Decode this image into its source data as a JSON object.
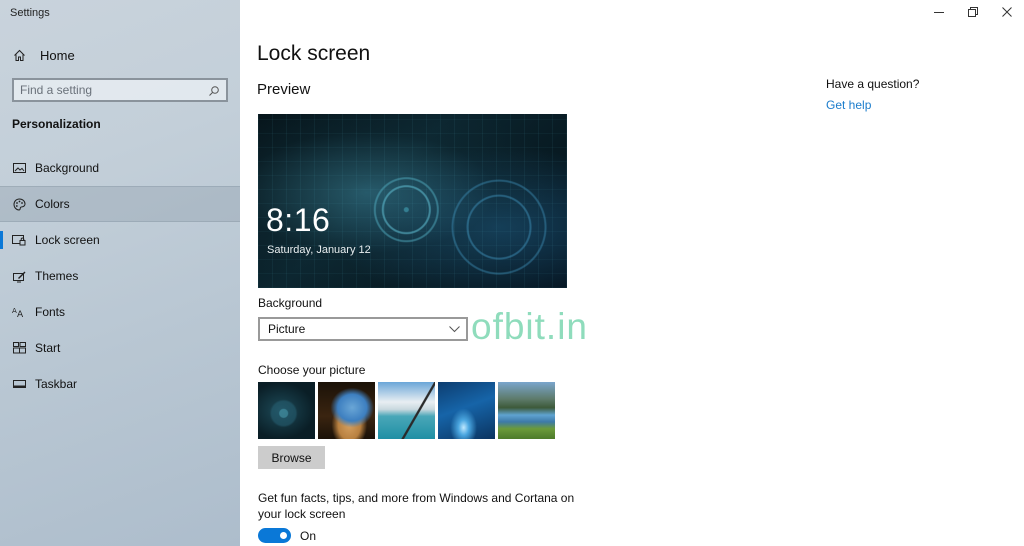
{
  "window": {
    "title": "Settings",
    "controls": [
      "minimize",
      "restore",
      "close"
    ]
  },
  "sidebar": {
    "home_label": "Home",
    "search": {
      "placeholder": "Find a setting",
      "value": ""
    },
    "section_heading": "Personalization",
    "items": [
      {
        "label": "Background",
        "icon": "picture-icon",
        "state": "normal"
      },
      {
        "label": "Colors",
        "icon": "palette-icon",
        "state": "hover"
      },
      {
        "label": "Lock screen",
        "icon": "lock-screen-icon",
        "state": "active"
      },
      {
        "label": "Themes",
        "icon": "themes-icon",
        "state": "normal"
      },
      {
        "label": "Fonts",
        "icon": "fonts-icon",
        "state": "normal"
      },
      {
        "label": "Start",
        "icon": "start-icon",
        "state": "normal"
      },
      {
        "label": "Taskbar",
        "icon": "taskbar-icon",
        "state": "normal"
      }
    ]
  },
  "main": {
    "title": "Lock screen",
    "preview": {
      "heading": "Preview",
      "time": "8:16",
      "date": "Saturday, January 12"
    },
    "background": {
      "label": "Background",
      "selected": "Picture"
    },
    "choose_picture": {
      "label": "Choose your picture",
      "thumbnails": [
        "Tech circles wallpaper",
        "Cave beach view",
        "Clouds over water",
        "Blue ice cave",
        "Mountain lake"
      ]
    },
    "browse_label": "Browse",
    "tips": {
      "text": "Get fun facts, tips, and more from Windows and Cortana on your lock screen",
      "toggle_on": true,
      "toggle_label": "On"
    }
  },
  "help": {
    "question": "Have a question?",
    "link": "Get help"
  },
  "watermark": "ofbit.in",
  "colors": {
    "accent": "#0a78d7",
    "link": "#1a7ccc",
    "watermark": "#8fdcbc"
  }
}
